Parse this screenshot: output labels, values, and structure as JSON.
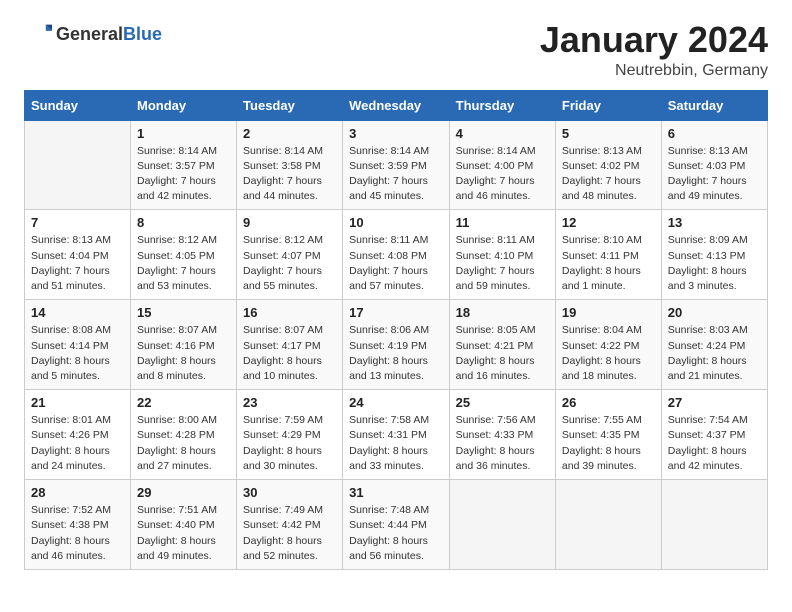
{
  "header": {
    "logo_general": "General",
    "logo_blue": "Blue",
    "month_title": "January 2024",
    "subtitle": "Neutrebbin, Germany"
  },
  "days_of_week": [
    "Sunday",
    "Monday",
    "Tuesday",
    "Wednesday",
    "Thursday",
    "Friday",
    "Saturday"
  ],
  "weeks": [
    [
      {
        "day": "",
        "sunrise": "",
        "sunset": "",
        "daylight": ""
      },
      {
        "day": "1",
        "sunrise": "Sunrise: 8:14 AM",
        "sunset": "Sunset: 3:57 PM",
        "daylight": "Daylight: 7 hours and 42 minutes."
      },
      {
        "day": "2",
        "sunrise": "Sunrise: 8:14 AM",
        "sunset": "Sunset: 3:58 PM",
        "daylight": "Daylight: 7 hours and 44 minutes."
      },
      {
        "day": "3",
        "sunrise": "Sunrise: 8:14 AM",
        "sunset": "Sunset: 3:59 PM",
        "daylight": "Daylight: 7 hours and 45 minutes."
      },
      {
        "day": "4",
        "sunrise": "Sunrise: 8:14 AM",
        "sunset": "Sunset: 4:00 PM",
        "daylight": "Daylight: 7 hours and 46 minutes."
      },
      {
        "day": "5",
        "sunrise": "Sunrise: 8:13 AM",
        "sunset": "Sunset: 4:02 PM",
        "daylight": "Daylight: 7 hours and 48 minutes."
      },
      {
        "day": "6",
        "sunrise": "Sunrise: 8:13 AM",
        "sunset": "Sunset: 4:03 PM",
        "daylight": "Daylight: 7 hours and 49 minutes."
      }
    ],
    [
      {
        "day": "7",
        "sunrise": "Sunrise: 8:13 AM",
        "sunset": "Sunset: 4:04 PM",
        "daylight": "Daylight: 7 hours and 51 minutes."
      },
      {
        "day": "8",
        "sunrise": "Sunrise: 8:12 AM",
        "sunset": "Sunset: 4:05 PM",
        "daylight": "Daylight: 7 hours and 53 minutes."
      },
      {
        "day": "9",
        "sunrise": "Sunrise: 8:12 AM",
        "sunset": "Sunset: 4:07 PM",
        "daylight": "Daylight: 7 hours and 55 minutes."
      },
      {
        "day": "10",
        "sunrise": "Sunrise: 8:11 AM",
        "sunset": "Sunset: 4:08 PM",
        "daylight": "Daylight: 7 hours and 57 minutes."
      },
      {
        "day": "11",
        "sunrise": "Sunrise: 8:11 AM",
        "sunset": "Sunset: 4:10 PM",
        "daylight": "Daylight: 7 hours and 59 minutes."
      },
      {
        "day": "12",
        "sunrise": "Sunrise: 8:10 AM",
        "sunset": "Sunset: 4:11 PM",
        "daylight": "Daylight: 8 hours and 1 minute."
      },
      {
        "day": "13",
        "sunrise": "Sunrise: 8:09 AM",
        "sunset": "Sunset: 4:13 PM",
        "daylight": "Daylight: 8 hours and 3 minutes."
      }
    ],
    [
      {
        "day": "14",
        "sunrise": "Sunrise: 8:08 AM",
        "sunset": "Sunset: 4:14 PM",
        "daylight": "Daylight: 8 hours and 5 minutes."
      },
      {
        "day": "15",
        "sunrise": "Sunrise: 8:07 AM",
        "sunset": "Sunset: 4:16 PM",
        "daylight": "Daylight: 8 hours and 8 minutes."
      },
      {
        "day": "16",
        "sunrise": "Sunrise: 8:07 AM",
        "sunset": "Sunset: 4:17 PM",
        "daylight": "Daylight: 8 hours and 10 minutes."
      },
      {
        "day": "17",
        "sunrise": "Sunrise: 8:06 AM",
        "sunset": "Sunset: 4:19 PM",
        "daylight": "Daylight: 8 hours and 13 minutes."
      },
      {
        "day": "18",
        "sunrise": "Sunrise: 8:05 AM",
        "sunset": "Sunset: 4:21 PM",
        "daylight": "Daylight: 8 hours and 16 minutes."
      },
      {
        "day": "19",
        "sunrise": "Sunrise: 8:04 AM",
        "sunset": "Sunset: 4:22 PM",
        "daylight": "Daylight: 8 hours and 18 minutes."
      },
      {
        "day": "20",
        "sunrise": "Sunrise: 8:03 AM",
        "sunset": "Sunset: 4:24 PM",
        "daylight": "Daylight: 8 hours and 21 minutes."
      }
    ],
    [
      {
        "day": "21",
        "sunrise": "Sunrise: 8:01 AM",
        "sunset": "Sunset: 4:26 PM",
        "daylight": "Daylight: 8 hours and 24 minutes."
      },
      {
        "day": "22",
        "sunrise": "Sunrise: 8:00 AM",
        "sunset": "Sunset: 4:28 PM",
        "daylight": "Daylight: 8 hours and 27 minutes."
      },
      {
        "day": "23",
        "sunrise": "Sunrise: 7:59 AM",
        "sunset": "Sunset: 4:29 PM",
        "daylight": "Daylight: 8 hours and 30 minutes."
      },
      {
        "day": "24",
        "sunrise": "Sunrise: 7:58 AM",
        "sunset": "Sunset: 4:31 PM",
        "daylight": "Daylight: 8 hours and 33 minutes."
      },
      {
        "day": "25",
        "sunrise": "Sunrise: 7:56 AM",
        "sunset": "Sunset: 4:33 PM",
        "daylight": "Daylight: 8 hours and 36 minutes."
      },
      {
        "day": "26",
        "sunrise": "Sunrise: 7:55 AM",
        "sunset": "Sunset: 4:35 PM",
        "daylight": "Daylight: 8 hours and 39 minutes."
      },
      {
        "day": "27",
        "sunrise": "Sunrise: 7:54 AM",
        "sunset": "Sunset: 4:37 PM",
        "daylight": "Daylight: 8 hours and 42 minutes."
      }
    ],
    [
      {
        "day": "28",
        "sunrise": "Sunrise: 7:52 AM",
        "sunset": "Sunset: 4:38 PM",
        "daylight": "Daylight: 8 hours and 46 minutes."
      },
      {
        "day": "29",
        "sunrise": "Sunrise: 7:51 AM",
        "sunset": "Sunset: 4:40 PM",
        "daylight": "Daylight: 8 hours and 49 minutes."
      },
      {
        "day": "30",
        "sunrise": "Sunrise: 7:49 AM",
        "sunset": "Sunset: 4:42 PM",
        "daylight": "Daylight: 8 hours and 52 minutes."
      },
      {
        "day": "31",
        "sunrise": "Sunrise: 7:48 AM",
        "sunset": "Sunset: 4:44 PM",
        "daylight": "Daylight: 8 hours and 56 minutes."
      },
      {
        "day": "",
        "sunrise": "",
        "sunset": "",
        "daylight": ""
      },
      {
        "day": "",
        "sunrise": "",
        "sunset": "",
        "daylight": ""
      },
      {
        "day": "",
        "sunrise": "",
        "sunset": "",
        "daylight": ""
      }
    ]
  ]
}
